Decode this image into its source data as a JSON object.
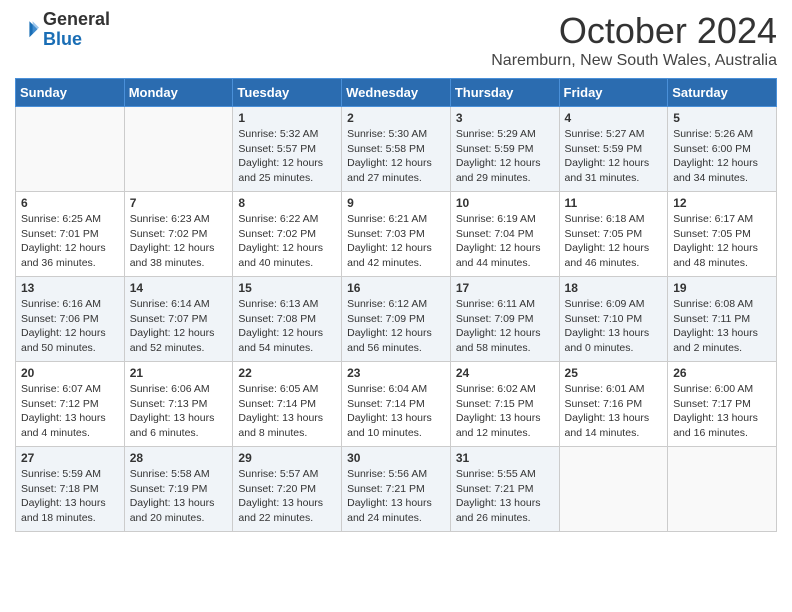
{
  "header": {
    "logo_general": "General",
    "logo_blue": "Blue",
    "month_title": "October 2024",
    "subtitle": "Naremburn, New South Wales, Australia"
  },
  "days_of_week": [
    "Sunday",
    "Monday",
    "Tuesday",
    "Wednesday",
    "Thursday",
    "Friday",
    "Saturday"
  ],
  "weeks": [
    [
      {
        "day": "",
        "info": ""
      },
      {
        "day": "",
        "info": ""
      },
      {
        "day": "1",
        "info": "Sunrise: 5:32 AM\nSunset: 5:57 PM\nDaylight: 12 hours\nand 25 minutes."
      },
      {
        "day": "2",
        "info": "Sunrise: 5:30 AM\nSunset: 5:58 PM\nDaylight: 12 hours\nand 27 minutes."
      },
      {
        "day": "3",
        "info": "Sunrise: 5:29 AM\nSunset: 5:59 PM\nDaylight: 12 hours\nand 29 minutes."
      },
      {
        "day": "4",
        "info": "Sunrise: 5:27 AM\nSunset: 5:59 PM\nDaylight: 12 hours\nand 31 minutes."
      },
      {
        "day": "5",
        "info": "Sunrise: 5:26 AM\nSunset: 6:00 PM\nDaylight: 12 hours\nand 34 minutes."
      }
    ],
    [
      {
        "day": "6",
        "info": "Sunrise: 6:25 AM\nSunset: 7:01 PM\nDaylight: 12 hours\nand 36 minutes."
      },
      {
        "day": "7",
        "info": "Sunrise: 6:23 AM\nSunset: 7:02 PM\nDaylight: 12 hours\nand 38 minutes."
      },
      {
        "day": "8",
        "info": "Sunrise: 6:22 AM\nSunset: 7:02 PM\nDaylight: 12 hours\nand 40 minutes."
      },
      {
        "day": "9",
        "info": "Sunrise: 6:21 AM\nSunset: 7:03 PM\nDaylight: 12 hours\nand 42 minutes."
      },
      {
        "day": "10",
        "info": "Sunrise: 6:19 AM\nSunset: 7:04 PM\nDaylight: 12 hours\nand 44 minutes."
      },
      {
        "day": "11",
        "info": "Sunrise: 6:18 AM\nSunset: 7:05 PM\nDaylight: 12 hours\nand 46 minutes."
      },
      {
        "day": "12",
        "info": "Sunrise: 6:17 AM\nSunset: 7:05 PM\nDaylight: 12 hours\nand 48 minutes."
      }
    ],
    [
      {
        "day": "13",
        "info": "Sunrise: 6:16 AM\nSunset: 7:06 PM\nDaylight: 12 hours\nand 50 minutes."
      },
      {
        "day": "14",
        "info": "Sunrise: 6:14 AM\nSunset: 7:07 PM\nDaylight: 12 hours\nand 52 minutes."
      },
      {
        "day": "15",
        "info": "Sunrise: 6:13 AM\nSunset: 7:08 PM\nDaylight: 12 hours\nand 54 minutes."
      },
      {
        "day": "16",
        "info": "Sunrise: 6:12 AM\nSunset: 7:09 PM\nDaylight: 12 hours\nand 56 minutes."
      },
      {
        "day": "17",
        "info": "Sunrise: 6:11 AM\nSunset: 7:09 PM\nDaylight: 12 hours\nand 58 minutes."
      },
      {
        "day": "18",
        "info": "Sunrise: 6:09 AM\nSunset: 7:10 PM\nDaylight: 13 hours\nand 0 minutes."
      },
      {
        "day": "19",
        "info": "Sunrise: 6:08 AM\nSunset: 7:11 PM\nDaylight: 13 hours\nand 2 minutes."
      }
    ],
    [
      {
        "day": "20",
        "info": "Sunrise: 6:07 AM\nSunset: 7:12 PM\nDaylight: 13 hours\nand 4 minutes."
      },
      {
        "day": "21",
        "info": "Sunrise: 6:06 AM\nSunset: 7:13 PM\nDaylight: 13 hours\nand 6 minutes."
      },
      {
        "day": "22",
        "info": "Sunrise: 6:05 AM\nSunset: 7:14 PM\nDaylight: 13 hours\nand 8 minutes."
      },
      {
        "day": "23",
        "info": "Sunrise: 6:04 AM\nSunset: 7:14 PM\nDaylight: 13 hours\nand 10 minutes."
      },
      {
        "day": "24",
        "info": "Sunrise: 6:02 AM\nSunset: 7:15 PM\nDaylight: 13 hours\nand 12 minutes."
      },
      {
        "day": "25",
        "info": "Sunrise: 6:01 AM\nSunset: 7:16 PM\nDaylight: 13 hours\nand 14 minutes."
      },
      {
        "day": "26",
        "info": "Sunrise: 6:00 AM\nSunset: 7:17 PM\nDaylight: 13 hours\nand 16 minutes."
      }
    ],
    [
      {
        "day": "27",
        "info": "Sunrise: 5:59 AM\nSunset: 7:18 PM\nDaylight: 13 hours\nand 18 minutes."
      },
      {
        "day": "28",
        "info": "Sunrise: 5:58 AM\nSunset: 7:19 PM\nDaylight: 13 hours\nand 20 minutes."
      },
      {
        "day": "29",
        "info": "Sunrise: 5:57 AM\nSunset: 7:20 PM\nDaylight: 13 hours\nand 22 minutes."
      },
      {
        "day": "30",
        "info": "Sunrise: 5:56 AM\nSunset: 7:21 PM\nDaylight: 13 hours\nand 24 minutes."
      },
      {
        "day": "31",
        "info": "Sunrise: 5:55 AM\nSunset: 7:21 PM\nDaylight: 13 hours\nand 26 minutes."
      },
      {
        "day": "",
        "info": ""
      },
      {
        "day": "",
        "info": ""
      }
    ]
  ]
}
